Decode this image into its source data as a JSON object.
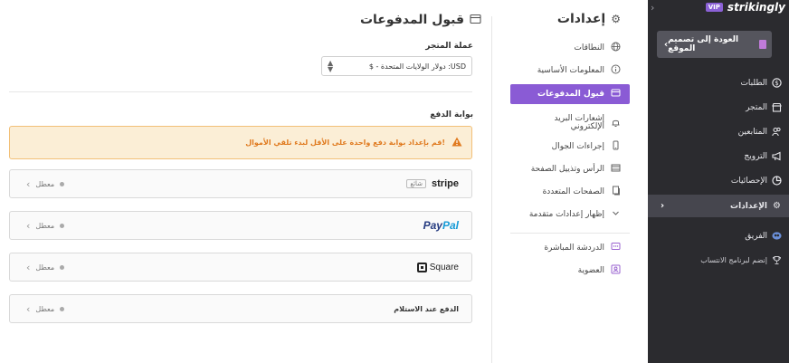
{
  "brand": {
    "name": "strikingly",
    "vip": "VIP"
  },
  "sidebar": {
    "back_label": "العودة إلى تصميم الموقع",
    "items": [
      {
        "label": "الطلبات",
        "icon": "dollar-icon"
      },
      {
        "label": "المتجر",
        "icon": "store-icon"
      },
      {
        "label": "المتابعين",
        "icon": "followers-icon"
      },
      {
        "label": "الترويج",
        "icon": "megaphone-icon"
      },
      {
        "label": "الإحصائيات",
        "icon": "pie-chart-icon"
      },
      {
        "label": "الإعدادات",
        "icon": "gear-icon",
        "active": true
      },
      {
        "label": "الفريق",
        "icon": "team-icon"
      },
      {
        "label": "إنضم لبرنامج الانتساب",
        "icon": "trophy-icon"
      }
    ]
  },
  "settings": {
    "title": "إعدادات",
    "items": [
      {
        "label": "النطاقات",
        "icon": "globe-icon"
      },
      {
        "label": "المعلومات الأساسية",
        "icon": "info-icon"
      },
      {
        "label": "قبول المدفوعات",
        "icon": "payment-card-icon",
        "active": true
      },
      {
        "label": "إشعارات البريد الإلكتروني",
        "icon": "bell-icon"
      },
      {
        "label": "إجراءات الجوال",
        "icon": "mobile-icon"
      },
      {
        "label": "الرأس وتذييل الصفحة",
        "icon": "header-footer-icon"
      },
      {
        "label": "الصفحات المتعددة",
        "icon": "pages-icon"
      },
      {
        "label": "إظهار إعدادات متقدمة",
        "icon": "chevron-down-icon"
      },
      {
        "label": "الدردشة المباشرة",
        "icon": "chat-icon"
      },
      {
        "label": "العضوية",
        "icon": "membership-icon"
      }
    ]
  },
  "main": {
    "title": "قبول المدفوعات",
    "currency_label": "عملة المتجر",
    "currency_value": "USD: دولار الولايات المتحدة - $",
    "gateway_label": "بوابة الدفع",
    "warning": "قم بإعداد بوابة دفع واحدة على الأقل لبدء تلقي الأموال!",
    "gateways": [
      {
        "name": "stripe",
        "tag": "شائع",
        "status": "معطل"
      },
      {
        "name_p1": "Pay",
        "name_p2": "Pal",
        "status": "معطل"
      },
      {
        "name": "Square",
        "status": "معطل"
      },
      {
        "name": "الدفع عند الاستلام",
        "status": "معطل"
      }
    ]
  },
  "colors": {
    "accent": "#8a5bd5",
    "sidebar_bg": "#2b2b2f",
    "warning_text": "#e07a1f"
  }
}
